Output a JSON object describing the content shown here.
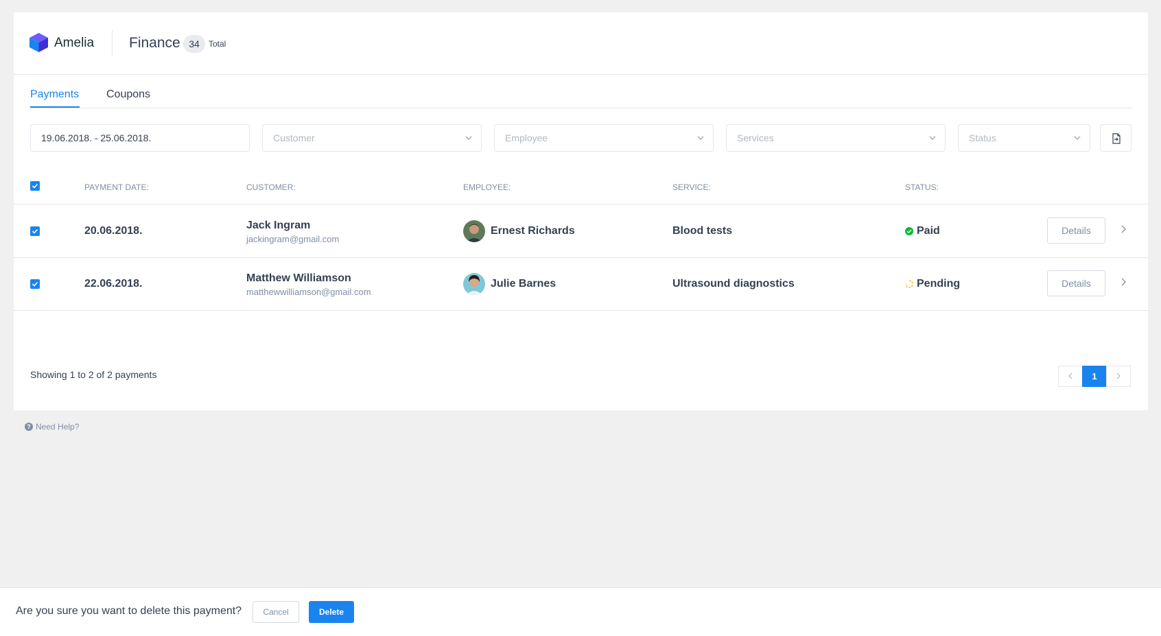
{
  "header": {
    "brand": "Amelia",
    "title": "Finance",
    "count": "34",
    "count_label": "Total"
  },
  "tabs": [
    {
      "label": "Payments",
      "active": true
    },
    {
      "label": "Coupons",
      "active": false
    }
  ],
  "filters": {
    "date_range": "19.06.2018. - 25.06.2018.",
    "customer_placeholder": "Customer",
    "employee_placeholder": "Employee",
    "services_placeholder": "Services",
    "status_placeholder": "Status",
    "export_icon": "export-file-icon"
  },
  "table": {
    "headers": [
      "PAYMENT DATE:",
      "CUSTOMER:",
      "EMPLOYEE:",
      "SERVICE:",
      "STATUS:"
    ],
    "rows": [
      {
        "date": "20.06.2018.",
        "customer_name": "Jack Ingram",
        "customer_email": "jackingram@gmail.com",
        "employee": "Ernest Richards",
        "service": "Blood tests",
        "status": "Paid",
        "status_color": "#00c02a",
        "details_label": "Details"
      },
      {
        "date": "22.06.2018.",
        "customer_name": "Matthew Williamson",
        "customer_email": "matthewwilliamson@gmail.com",
        "employee": "Julie Barnes",
        "service": "Ultrasound diagnostics",
        "status": "Pending",
        "status_color": "#f0c419",
        "details_label": "Details"
      }
    ]
  },
  "footer": {
    "showing": "Showing 1 to 2 of 2 payments",
    "current_page": "1"
  },
  "help": {
    "label": "Need Help?"
  },
  "confirm": {
    "question": "Are you sure you want to delete this payment?",
    "cancel_label": "Cancel",
    "delete_label": "Delete"
  },
  "colors": {
    "accent": "#1a84ee",
    "paid": "#00c02a",
    "pending": "#f0c419"
  }
}
